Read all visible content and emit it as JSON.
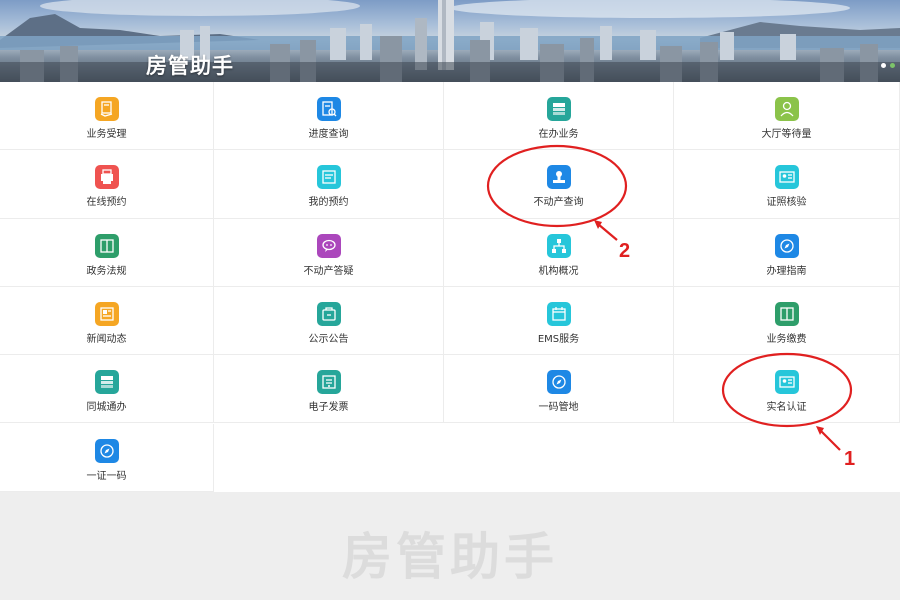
{
  "banner": {
    "title": "房管助手"
  },
  "grid": [
    [
      {
        "label": "业务受理",
        "icon": "document-hand-icon",
        "color": "#f5a623"
      },
      {
        "label": "进度查询",
        "icon": "document-search-icon",
        "color": "#1e88e5"
      },
      {
        "label": "在办业务",
        "icon": "stacked-docs-icon",
        "color": "#26a69a"
      },
      {
        "label": "大厅等待量",
        "icon": "person-queue-icon",
        "color": "#8bc34a"
      }
    ],
    [
      {
        "label": "在线预约",
        "icon": "printer-icon",
        "color": "#ef5350"
      },
      {
        "label": "我的预约",
        "icon": "calendar-note-icon",
        "color": "#26c6da"
      },
      {
        "label": "不动产查询",
        "icon": "stamp-icon",
        "color": "#1e88e5"
      },
      {
        "label": "证照核验",
        "icon": "id-card-icon",
        "color": "#26c6da"
      }
    ],
    [
      {
        "label": "政务法规",
        "icon": "book-icon",
        "color": "#2e9e6a"
      },
      {
        "label": "不动产答疑",
        "icon": "chat-bubble-icon",
        "color": "#ab47bc"
      },
      {
        "label": "机构概况",
        "icon": "org-chart-icon",
        "color": "#26c6da"
      },
      {
        "label": "办理指南",
        "icon": "compass-icon",
        "color": "#1e88e5"
      }
    ],
    [
      {
        "label": "新闻动态",
        "icon": "newspaper-icon",
        "color": "#f5a623"
      },
      {
        "label": "公示公告",
        "icon": "notice-bag-icon",
        "color": "#26a69a"
      },
      {
        "label": "EMS服务",
        "icon": "calendar-icon",
        "color": "#26c6da"
      },
      {
        "label": "业务缴费",
        "icon": "book-icon",
        "color": "#2e9e6a"
      }
    ],
    [
      {
        "label": "同城通办",
        "icon": "stacked-docs-icon",
        "color": "#26a69a"
      },
      {
        "label": "电子发票",
        "icon": "invoice-icon",
        "color": "#26a69a"
      },
      {
        "label": "一码管地",
        "icon": "compass-icon",
        "color": "#1e88e5"
      },
      {
        "label": "实名认证",
        "icon": "id-card-icon",
        "color": "#26c6da"
      }
    ],
    [
      {
        "label": "一证一码",
        "icon": "compass-icon",
        "color": "#1e88e5"
      }
    ]
  ],
  "footer": {
    "title": "房管助手"
  },
  "annotations": [
    {
      "number": "1",
      "target": "实名认证",
      "color": "#e02020"
    },
    {
      "number": "2",
      "target": "不动产查询",
      "color": "#e02020"
    }
  ]
}
